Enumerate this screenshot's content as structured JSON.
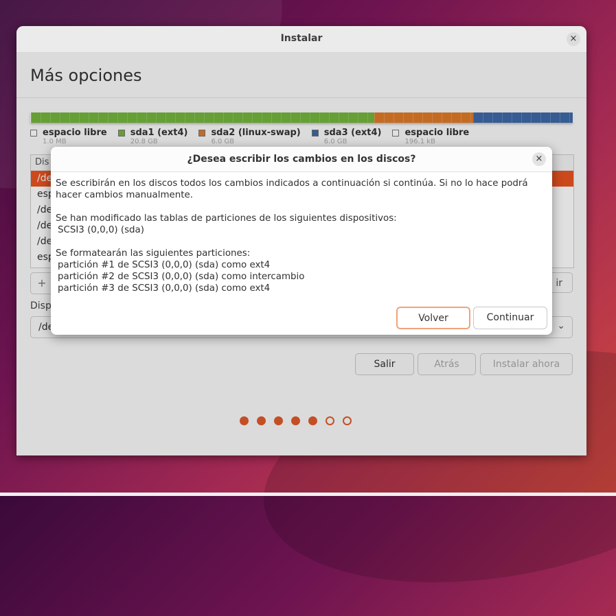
{
  "window": {
    "title": "Instalar",
    "close_glyph": "×"
  },
  "page": {
    "heading": "Más opciones"
  },
  "partition_bar": [
    {
      "name": "espacio libre",
      "size": "1.0 MB",
      "color": "#ffffff",
      "weight": 0.05
    },
    {
      "name": "sda1 (ext4)",
      "size": "20.8 GB",
      "color": "#73b53d",
      "weight": 20.8
    },
    {
      "name": "sda2 (linux-swap)",
      "size": "6.0 GB",
      "color": "#e07a28",
      "weight": 6.0
    },
    {
      "name": "sda3 (ext4)",
      "size": "6.0 GB",
      "color": "#3e69a8",
      "weight": 6.0
    },
    {
      "name": "espacio libre",
      "size": "196.1 kB",
      "color": "#ffffff",
      "weight": 0.02
    }
  ],
  "table": {
    "header": "Dis",
    "rows": [
      "/de",
      "esp",
      "/de",
      "/de",
      "/de",
      "esp"
    ]
  },
  "toolbar": {
    "add_label": "+",
    "revert_label": "ir"
  },
  "boot": {
    "label": "Disp",
    "value": "/de",
    "chevron": "⌄"
  },
  "buttons": {
    "quit": "Salir",
    "back": "Atrás",
    "install": "Instalar ahora"
  },
  "progress": {
    "steps_total": 7,
    "steps_done": 5,
    "color": "#e05a2b"
  },
  "dialog": {
    "title": "¿Desea escribir los cambios en los discos?",
    "close_glyph": "×",
    "intro": "Se escribirán en los discos todos los cambios indicados a continuación si continúa. Si no lo hace podrá hacer cambios manualmente.",
    "modified_heading": "Se han modificado las tablas de particiones de los siguientes dispositivos:",
    "devices": [
      "SCSI3 (0,0,0) (sda)"
    ],
    "format_heading": "Se formatearán las siguientes particiones:",
    "partitions": [
      "partición #1 de SCSI3 (0,0,0) (sda) como ext4",
      "partición #2 de SCSI3 (0,0,0) (sda) como intercambio",
      "partición #3 de SCSI3 (0,0,0) (sda) como ext4"
    ],
    "back_label": "Volver",
    "continue_label": "Continuar"
  }
}
